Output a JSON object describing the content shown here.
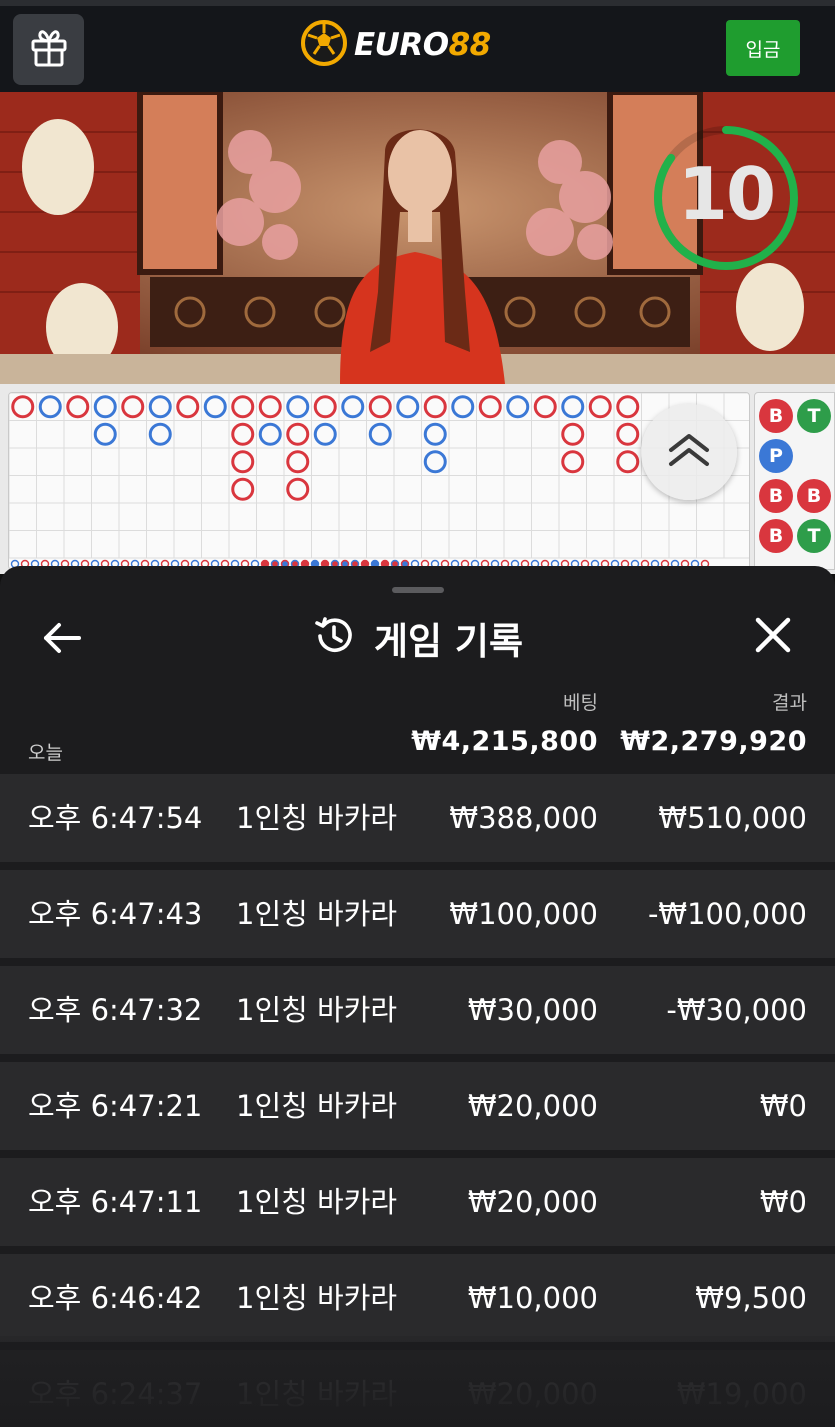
{
  "header": {
    "logo": {
      "euro": "EURO",
      "num": "88"
    },
    "deposit_label": "입금",
    "icons": {
      "gift": "gift-icon",
      "logo_ball": "soccer-ball-icon"
    }
  },
  "video": {
    "countdown": "10",
    "countdown_progress": 0.85
  },
  "roadmap": {
    "side_labels": [
      "B",
      "T",
      "P",
      "B",
      "B",
      "B",
      "T"
    ],
    "colors": {
      "banker": "#d9363e",
      "player": "#3b78d6",
      "tie": "#2e9d4a"
    }
  },
  "history": {
    "title": "게임 기록",
    "icons": {
      "back": "arrow-left-icon",
      "history": "history-icon",
      "close": "close-icon",
      "scroll_up": "chevron-double-up-icon"
    },
    "columns": {
      "bet": "베팅",
      "result": "결과"
    },
    "summary": {
      "label": "오늘",
      "bet_total": "₩4,215,800",
      "result_total": "₩2,279,920"
    },
    "rows": [
      {
        "time": "오후 6:47:54",
        "game": "1인칭 바카라",
        "bet": "₩388,000",
        "result": "₩510,000"
      },
      {
        "time": "오후 6:47:43",
        "game": "1인칭 바카라",
        "bet": "₩100,000",
        "result": "-₩100,000"
      },
      {
        "time": "오후 6:47:32",
        "game": "1인칭 바카라",
        "bet": "₩30,000",
        "result": "-₩30,000"
      },
      {
        "time": "오후 6:47:21",
        "game": "1인칭 바카라",
        "bet": "₩20,000",
        "result": "₩0"
      },
      {
        "time": "오후 6:47:11",
        "game": "1인칭 바카라",
        "bet": "₩20,000",
        "result": "₩0"
      },
      {
        "time": "오후 6:46:42",
        "game": "1인칭 바카라",
        "bet": "₩10,000",
        "result": "₩9,500"
      },
      {
        "time": "오후 6:24:37",
        "game": "1인칭 바카라",
        "bet": "₩20,000",
        "result": "₩19,000"
      }
    ]
  }
}
